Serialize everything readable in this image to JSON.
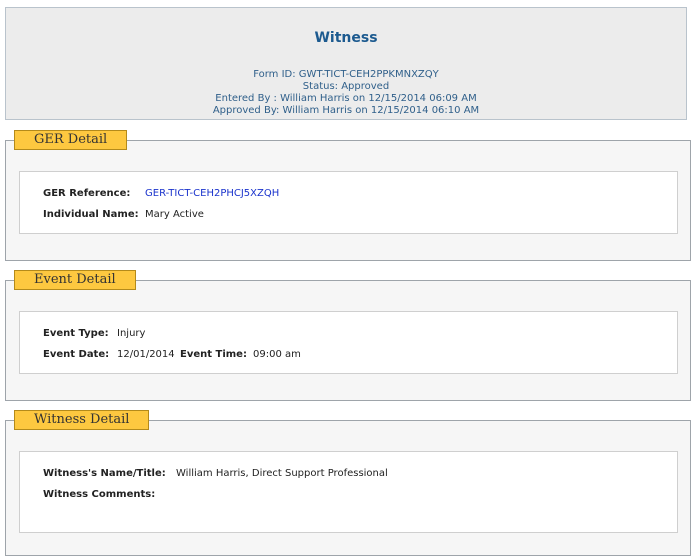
{
  "header": {
    "title": "Witness",
    "form_id": "Form ID: GWT-TICT-CEH2PPKMNXZQY",
    "status": "Status: Approved",
    "entered_by": "Entered By : William Harris  on 12/15/2014 06:09 AM",
    "approved_by": "Approved By: William Harris  on 12/15/2014 06:10 AM"
  },
  "ger_detail": {
    "legend": "GER Detail",
    "ger_reference_label": "GER Reference:",
    "ger_reference_value": "GER-TICT-CEH2PHCJ5XZQH",
    "individual_name_label": "Individual Name:",
    "individual_name_value": "Mary Active"
  },
  "event_detail": {
    "legend": "Event Detail",
    "event_type_label": "Event Type:",
    "event_type_value": "Injury",
    "event_date_label": "Event Date:",
    "event_date_value": "12/01/2014",
    "event_time_label": "Event Time:",
    "event_time_value": "09:00 am"
  },
  "witness_detail": {
    "legend": "Witness Detail",
    "witness_name_label": "Witness's Name/Title:",
    "witness_name_value": "William Harris, Direct Support Professional",
    "witness_comments_label": "Witness Comments:",
    "witness_comments_value": ""
  }
}
